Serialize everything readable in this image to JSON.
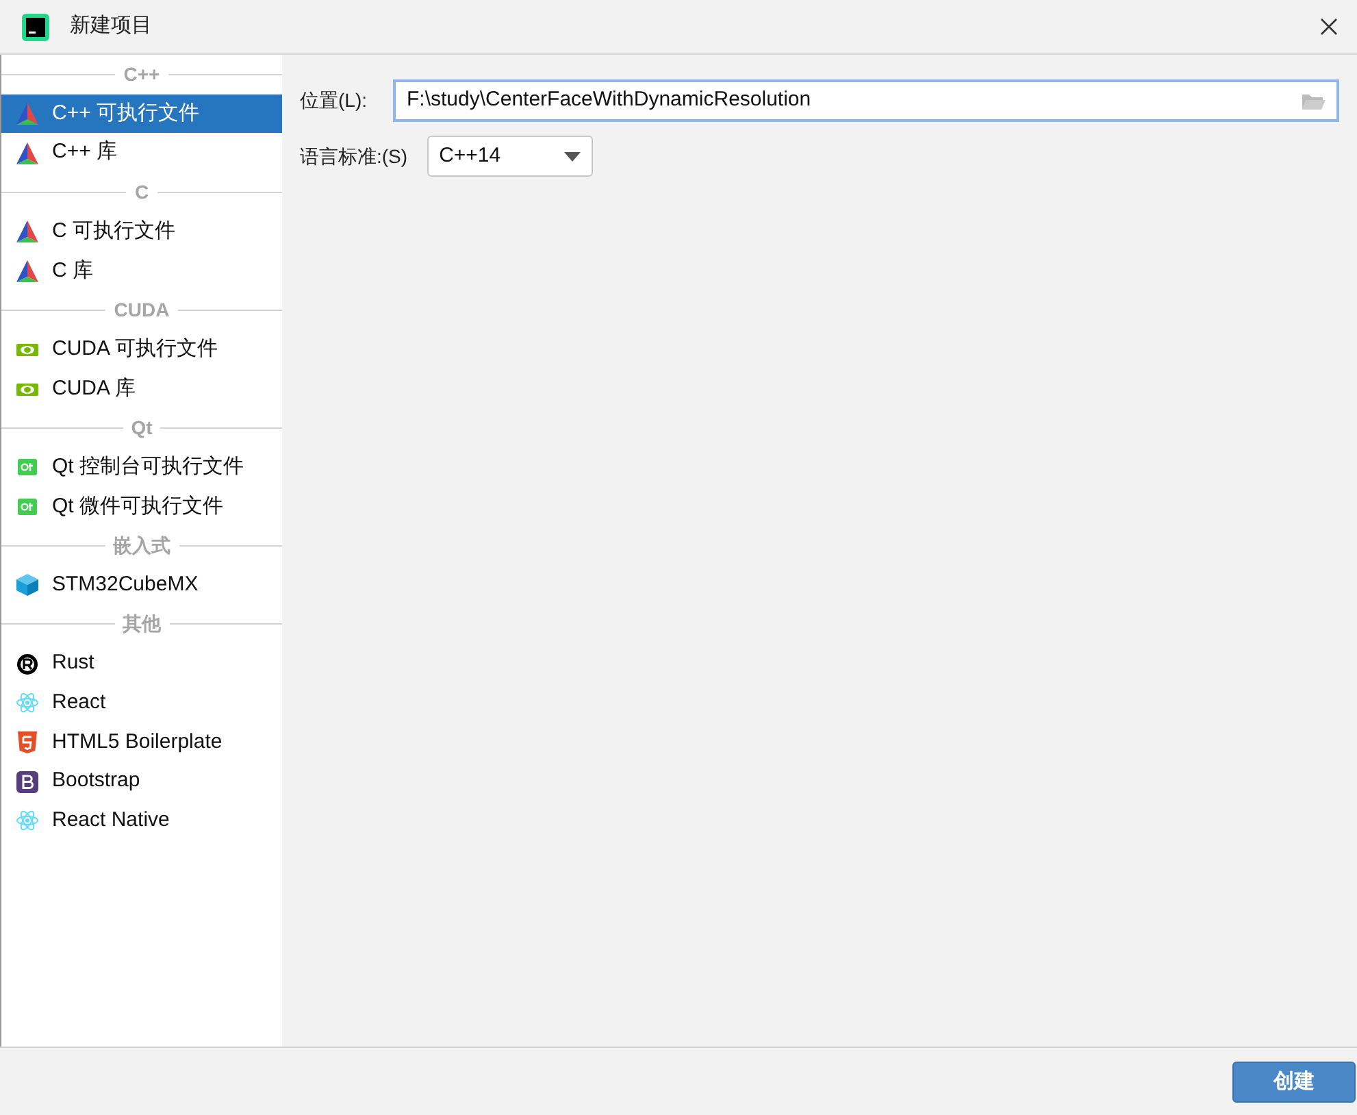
{
  "window": {
    "title": "新建项目"
  },
  "sidebar": {
    "sections": [
      {
        "title": "C++",
        "items": [
          {
            "label": "C++ 可执行文件",
            "kind": "cmake",
            "selected": true
          },
          {
            "label": "C++ 库",
            "kind": "cmake",
            "selected": false
          }
        ]
      },
      {
        "title": "C",
        "items": [
          {
            "label": "C 可执行文件",
            "kind": "cmake",
            "selected": false
          },
          {
            "label": "C 库",
            "kind": "cmake",
            "selected": false
          }
        ]
      },
      {
        "title": "CUDA",
        "items": [
          {
            "label": "CUDA 可执行文件",
            "kind": "nvidia",
            "selected": false
          },
          {
            "label": "CUDA 库",
            "kind": "nvidia",
            "selected": false
          }
        ]
      },
      {
        "title": "Qt",
        "items": [
          {
            "label": "Qt 控制台可执行文件",
            "kind": "qt",
            "selected": false
          },
          {
            "label": "Qt 微件可执行文件",
            "kind": "qt",
            "selected": false
          }
        ]
      },
      {
        "title": "嵌入式",
        "items": [
          {
            "label": "STM32CubeMX",
            "kind": "cube",
            "selected": false
          }
        ]
      },
      {
        "title": "其他",
        "items": [
          {
            "label": "Rust",
            "kind": "rust",
            "selected": false
          },
          {
            "label": "React",
            "kind": "react",
            "selected": false
          },
          {
            "label": "HTML5 Boilerplate",
            "kind": "html5",
            "selected": false
          },
          {
            "label": "Bootstrap",
            "kind": "bootstrap",
            "selected": false
          },
          {
            "label": "React Native",
            "kind": "react",
            "selected": false
          }
        ]
      }
    ]
  },
  "form": {
    "location": {
      "label": "位置(L):",
      "value": "F:\\study\\CenterFaceWithDynamicResolution"
    },
    "language_standard": {
      "label": "语言标准:(S)",
      "value": "C++14"
    }
  },
  "buttons": [
    "创建"
  ]
}
